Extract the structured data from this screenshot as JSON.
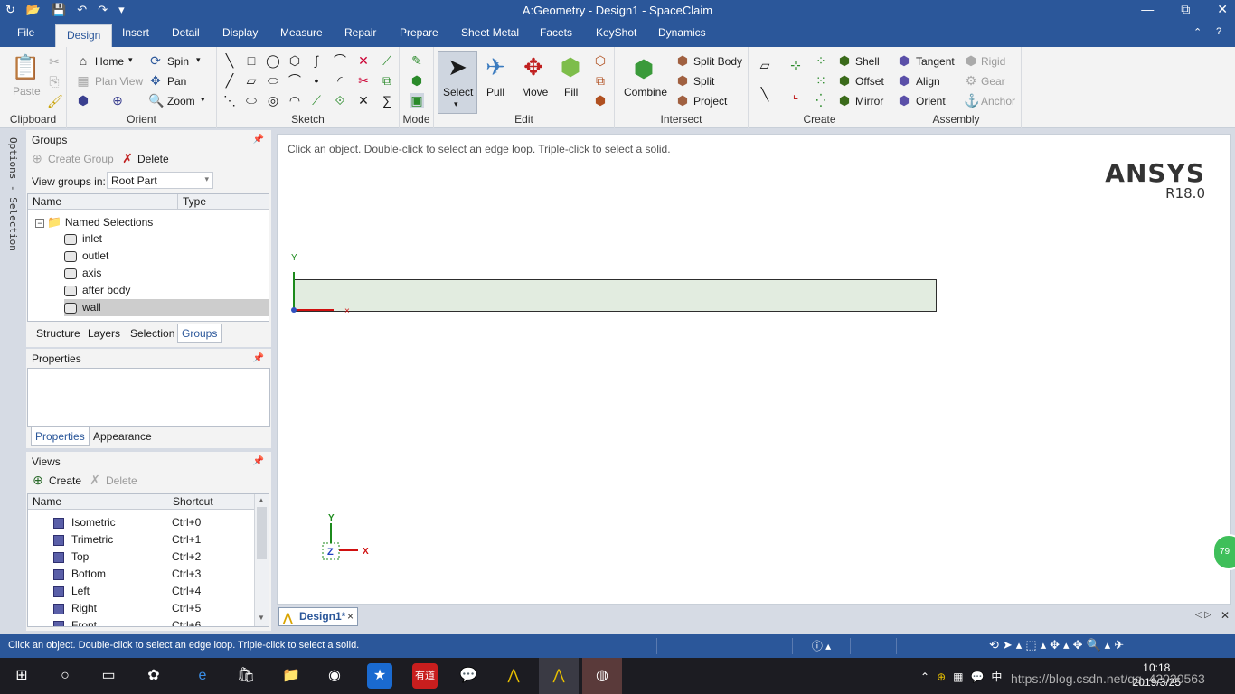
{
  "window": {
    "title": "A:Geometry - Design1 - SpaceClaim",
    "minimize": "—",
    "maximize": "⧉",
    "close": "✕"
  },
  "qat": [
    "↻",
    "📂",
    "💾",
    "↶",
    "↷",
    "▾"
  ],
  "tabs": [
    {
      "label": "File"
    },
    {
      "label": "Design"
    },
    {
      "label": "Insert"
    },
    {
      "label": "Detail"
    },
    {
      "label": "Display"
    },
    {
      "label": "Measure"
    },
    {
      "label": "Repair"
    },
    {
      "label": "Prepare"
    },
    {
      "label": "Sheet Metal"
    },
    {
      "label": "Facets"
    },
    {
      "label": "KeyShot"
    },
    {
      "label": "Dynamics"
    }
  ],
  "ribbon": {
    "clipboard": {
      "name": "Clipboard",
      "paste": "Paste"
    },
    "orient": {
      "name": "Orient",
      "home": "Home",
      "spin": "Spin",
      "plan_view": "Plan View",
      "pan": "Pan",
      "zoom": "Zoom"
    },
    "sketch": {
      "name": "Sketch"
    },
    "mode": {
      "name": "Mode"
    },
    "edit": {
      "name": "Edit",
      "select": "Select",
      "pull": "Pull",
      "move": "Move",
      "fill": "Fill"
    },
    "intersect": {
      "name": "Intersect",
      "combine": "Combine",
      "split_body": "Split Body",
      "split": "Split",
      "project": "Project"
    },
    "create": {
      "name": "Create",
      "shell": "Shell",
      "offset": "Offset",
      "mirror": "Mirror"
    },
    "assembly": {
      "name": "Assembly",
      "tangent": "Tangent",
      "align": "Align",
      "orient": "Orient",
      "rigid": "Rigid",
      "gear": "Gear",
      "anchor": "Anchor"
    }
  },
  "side_tab": "Options - Selection",
  "groups_panel": {
    "title": "Groups",
    "create_group": "Create Group",
    "delete": "Delete",
    "view_groups_label": "View groups in:",
    "view_groups_value": "Root Part",
    "col_name": "Name",
    "col_type": "Type",
    "root": "Named Selections",
    "items": [
      {
        "label": "inlet"
      },
      {
        "label": "outlet"
      },
      {
        "label": "axis"
      },
      {
        "label": "after body"
      },
      {
        "label": "wall"
      }
    ],
    "tabs": [
      {
        "label": "Structure"
      },
      {
        "label": "Layers"
      },
      {
        "label": "Selection"
      },
      {
        "label": "Groups"
      }
    ]
  },
  "properties_panel": {
    "title": "Properties",
    "tabs": [
      {
        "label": "Properties"
      },
      {
        "label": "Appearance"
      }
    ]
  },
  "views_panel": {
    "title": "Views",
    "create": "Create",
    "delete": "Delete",
    "col_name": "Name",
    "col_shortcut": "Shortcut",
    "items": [
      {
        "name": "Isometric",
        "shortcut": "Ctrl+0"
      },
      {
        "name": "Trimetric",
        "shortcut": "Ctrl+1"
      },
      {
        "name": "Top",
        "shortcut": "Ctrl+2"
      },
      {
        "name": "Bottom",
        "shortcut": "Ctrl+3"
      },
      {
        "name": "Left",
        "shortcut": "Ctrl+4"
      },
      {
        "name": "Right",
        "shortcut": "Ctrl+5"
      },
      {
        "name": "Front",
        "shortcut": "Ctrl+6"
      }
    ]
  },
  "viewport": {
    "hint": "Click an object. Double-click to select an edge loop. Triple-click to select a solid.",
    "brand": "ANSYS",
    "version": "R18.0",
    "axis_y": "Y",
    "axis_x": "X",
    "axis_z": "Z",
    "badge": "79"
  },
  "doc_tab": {
    "label": "Design1*"
  },
  "status": {
    "message": "Click an object. Double-click to select an edge loop. Triple-click to select a solid."
  },
  "taskbar": {
    "time": "10:18",
    "date": "2019/3/25",
    "ime": "中",
    "watermark": "https://blog.csdn.net/qq_42020563"
  }
}
